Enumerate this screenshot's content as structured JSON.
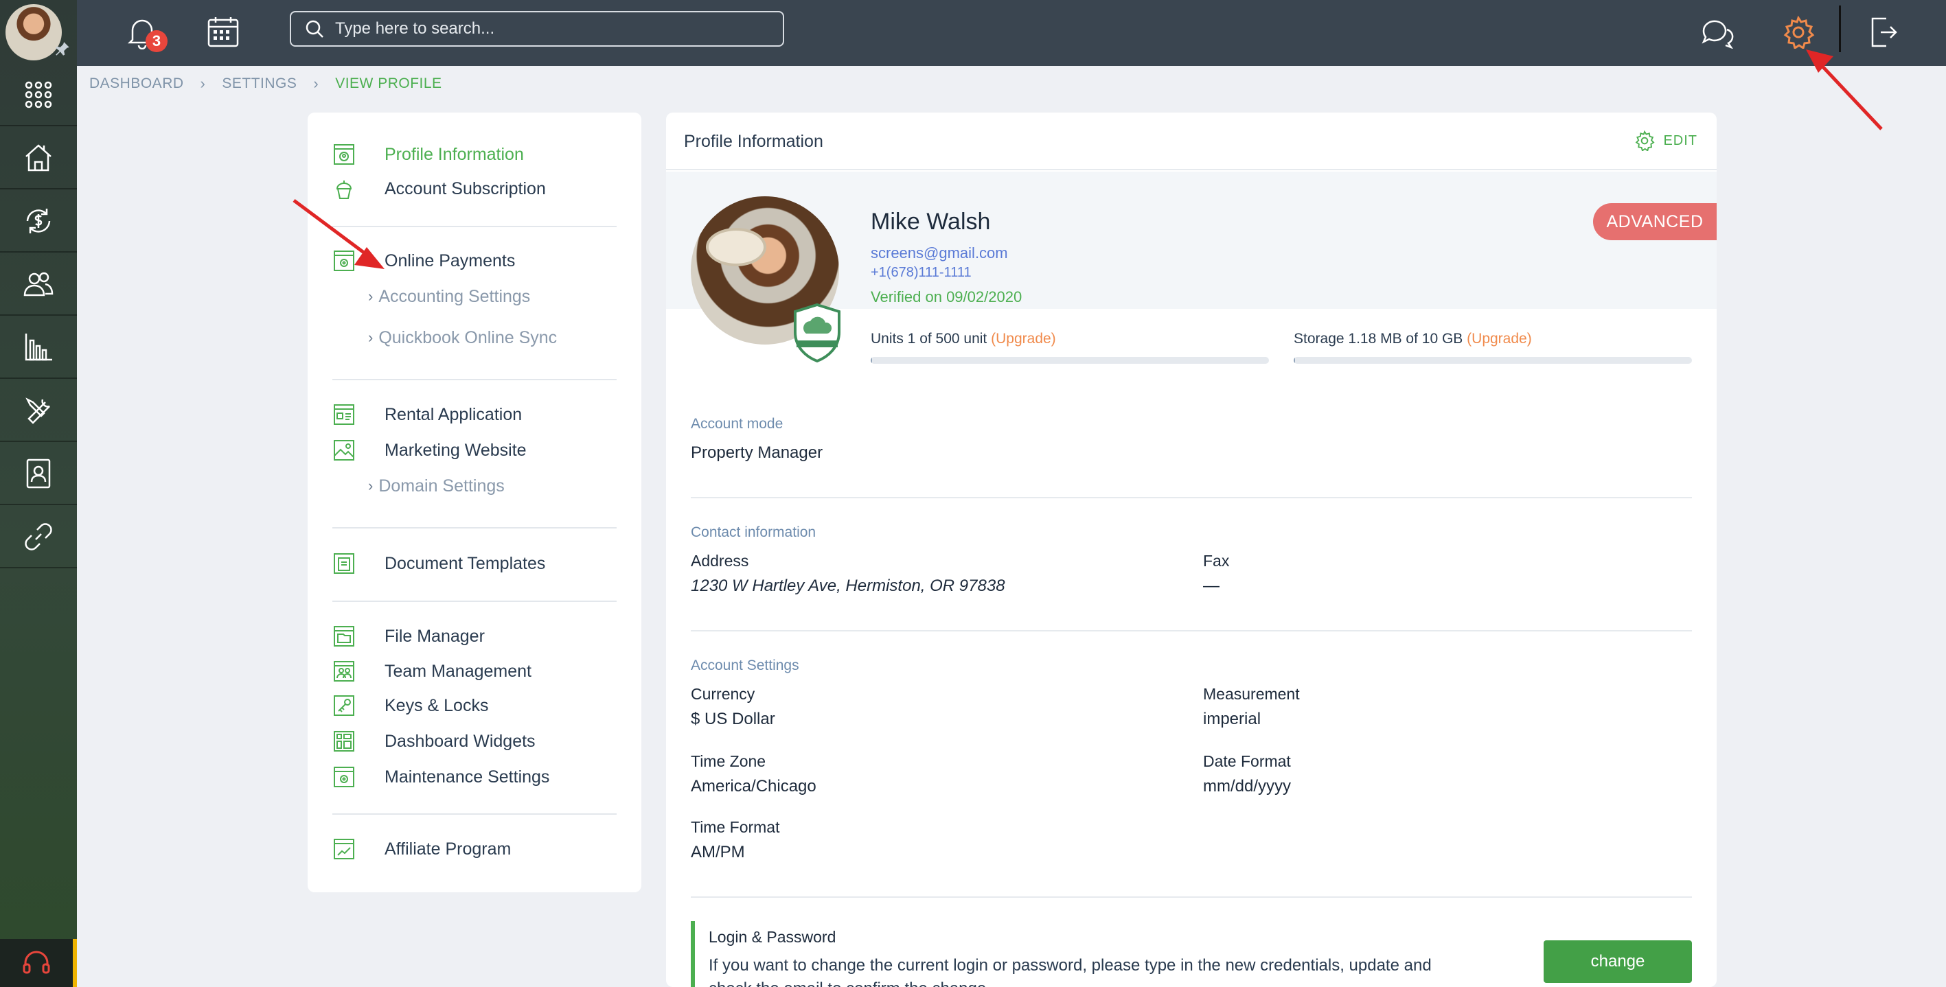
{
  "topbar": {
    "notifications_count": "3",
    "search_placeholder": "Type here to search..."
  },
  "breadcrumb": [
    "DASHBOARD",
    "SETTINGS",
    "VIEW PROFILE"
  ],
  "menu": {
    "profile_information": "Profile Information",
    "account_subscription": "Account Subscription",
    "online_payments": "Online Payments",
    "accounting_settings": "Accounting Settings",
    "quickbook_online_sync": "Quickbook Online Sync",
    "rental_application": "Rental Application",
    "marketing_website": "Marketing Website",
    "domain_settings": "Domain Settings",
    "document_templates": "Document Templates",
    "file_manager": "File Manager",
    "team_management": "Team Management",
    "keys_locks": "Keys & Locks",
    "dashboard_widgets": "Dashboard Widgets",
    "maintenance_settings": "Maintenance Settings",
    "affiliate_program": "Affiliate Program"
  },
  "profile": {
    "card_title": "Profile Information",
    "edit_label": "EDIT",
    "name": "Mike Walsh",
    "email": "screens@gmail.com",
    "phone": "+1(678)111-1111",
    "verified": "Verified on 09/02/2020",
    "plan_badge": "ADVANCED",
    "units_text": "Units 1 of 500 unit",
    "storage_text": "Storage 1.18 MB of 10 GB",
    "upgrade_label": "(Upgrade)",
    "units_fraction": 0.002,
    "storage_fraction": 0.0001
  },
  "account_mode": {
    "label": "Account mode",
    "value": "Property Manager"
  },
  "contact": {
    "label": "Contact information",
    "address_label": "Address",
    "address_value": "1230 W Hartley Ave, Hermiston, OR 97838",
    "fax_label": "Fax",
    "fax_value": "—"
  },
  "account_settings": {
    "label": "Account Settings",
    "currency_label": "Currency",
    "currency_value": "$ US Dollar",
    "measurement_label": "Measurement",
    "measurement_value": "imperial",
    "timezone_label": "Time Zone",
    "timezone_value": "America/Chicago",
    "dateformat_label": "Date Format",
    "dateformat_value": "mm/dd/yyyy",
    "timeformat_label": "Time Format",
    "timeformat_value": "AM/PM"
  },
  "login": {
    "title": "Login & Password",
    "text": "If you want to change the current login or password, please type in the new credentials, update and check the email to confirm the change.",
    "button": "change"
  },
  "colors": {
    "accent_green": "#4caf50",
    "badge_red": "#e6706f",
    "upgrade_orange": "#f08a4b",
    "topbar": "#3a4550"
  }
}
